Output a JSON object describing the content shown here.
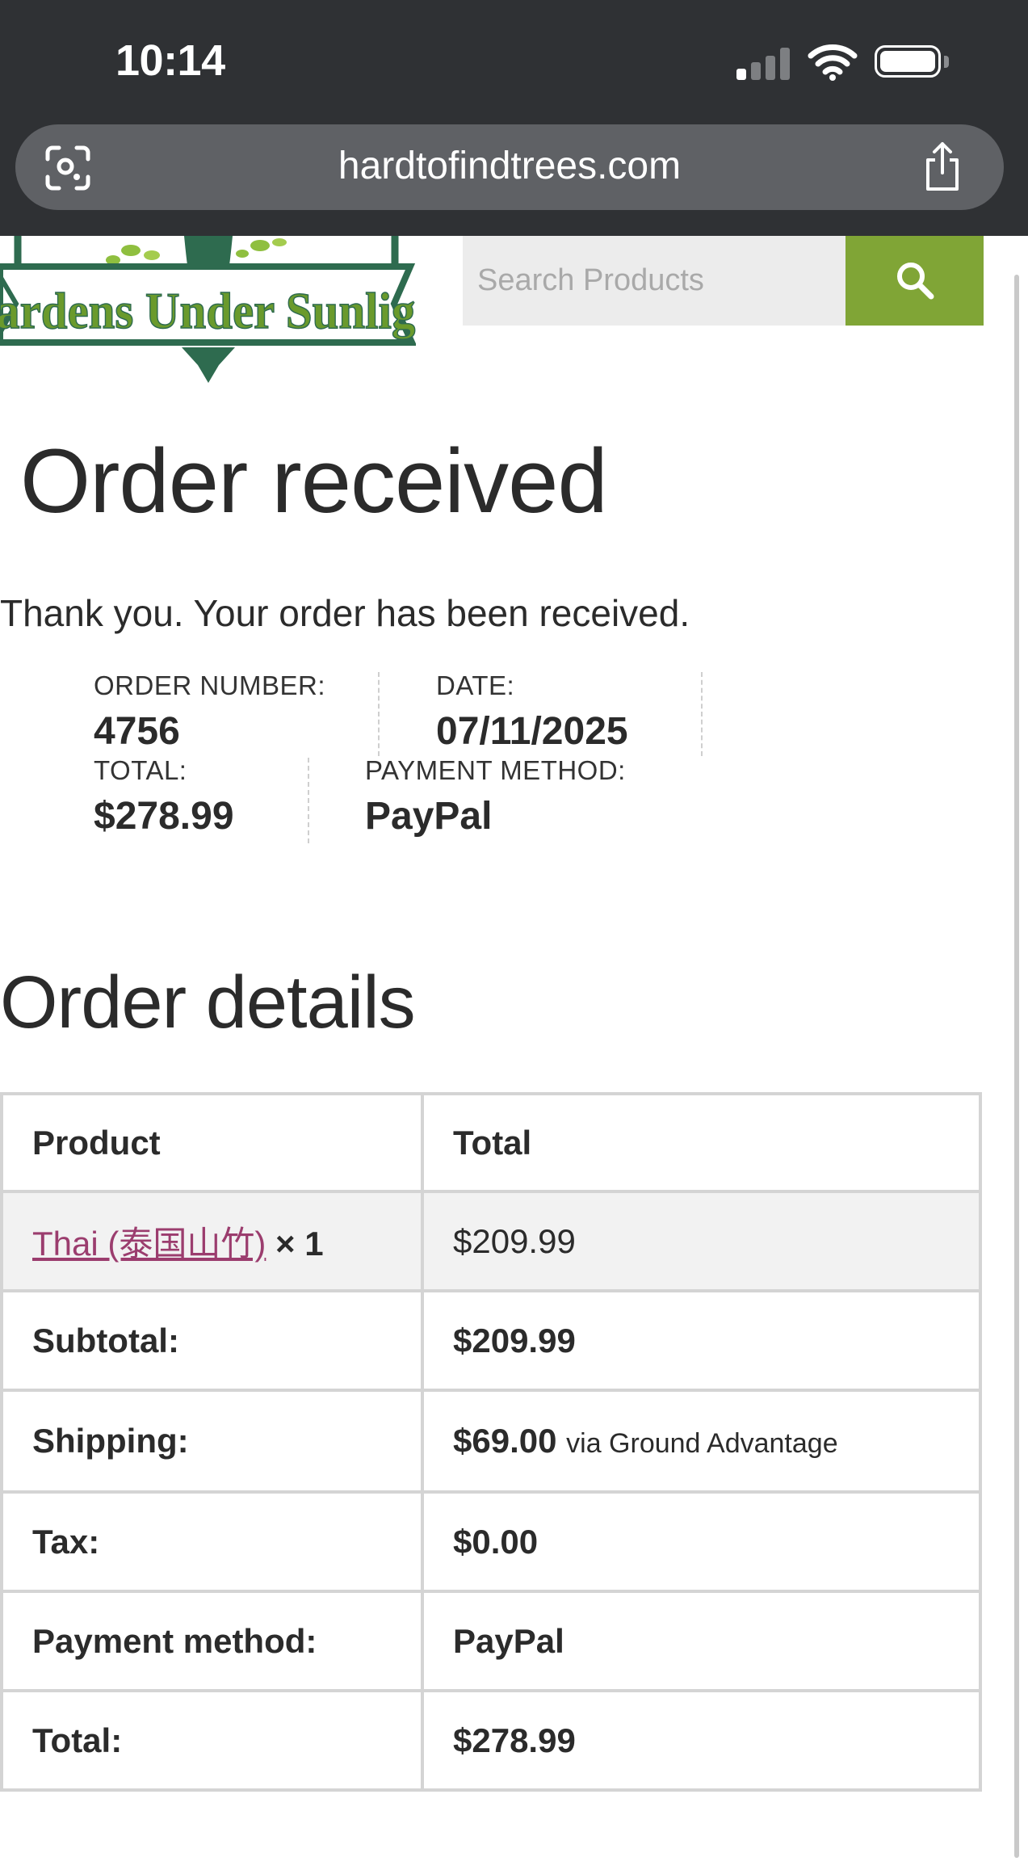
{
  "status_bar": {
    "time": "10:14"
  },
  "browser": {
    "url": "hardtofindtrees.com"
  },
  "header": {
    "logo_text": "Gardens Under Sunlight",
    "search_placeholder": "Search Products",
    "colors": {
      "search_button": "#80a536",
      "logo_green": "#2e6b4f",
      "logo_text": "#6a9a2c"
    }
  },
  "page": {
    "title": "Order received",
    "thank_you": "Thank you. Your order has been received."
  },
  "order_overview": {
    "order_number": {
      "label": "ORDER NUMBER:",
      "value": "4756"
    },
    "date": {
      "label": "DATE:",
      "value": "07/11/2025"
    },
    "total": {
      "label": "TOTAL:",
      "value": "$278.99"
    },
    "payment_method": {
      "label": "PAYMENT METHOD:",
      "value": "PayPal"
    }
  },
  "order_details": {
    "title": "Order details",
    "headers": {
      "product": "Product",
      "total": "Total"
    },
    "items": [
      {
        "name": "Thai (泰国山竹)",
        "quantity": "× 1",
        "total": "$209.99"
      }
    ],
    "subtotal": {
      "label": "Subtotal:",
      "value": "$209.99"
    },
    "shipping": {
      "label": "Shipping:",
      "value": "$69.00",
      "via": "via Ground Advantage"
    },
    "tax": {
      "label": "Tax:",
      "value": "$0.00"
    },
    "payment_method": {
      "label": "Payment method:",
      "value": "PayPal"
    },
    "total": {
      "label": "Total:",
      "value": "$278.99"
    },
    "colors": {
      "link": "#9b3d6e",
      "border": "#d4d4d4",
      "item_row_bg": "#f2f2f2"
    }
  }
}
